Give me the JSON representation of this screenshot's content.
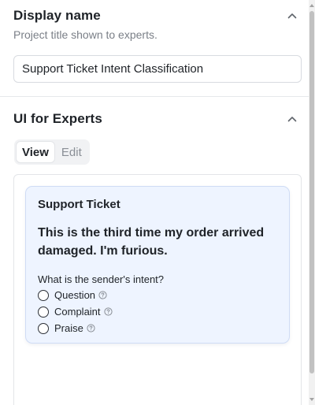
{
  "display_name": {
    "title": "Display name",
    "subtitle": "Project title shown to experts.",
    "value": "Support Ticket Intent Classification"
  },
  "ui_for_experts": {
    "title": "UI for Experts",
    "tabs": [
      {
        "label": "View",
        "active": true
      },
      {
        "label": "Edit",
        "active": false
      }
    ],
    "preview": {
      "card_title": "Support Ticket",
      "message": "This is the third time my order arrived damaged. I'm furious.",
      "question": "What is the sender's intent?",
      "options": [
        {
          "label": "Question",
          "icon": "help-circle-icon"
        },
        {
          "label": "Complaint",
          "icon": "help-circle-icon"
        },
        {
          "label": "Praise",
          "icon": "help-circle-icon"
        }
      ],
      "card_background": "#eef4ff",
      "card_border": "#cfdcf5"
    }
  },
  "icons": {
    "collapse": "chevron-up-icon",
    "help": "help-circle-icon"
  }
}
